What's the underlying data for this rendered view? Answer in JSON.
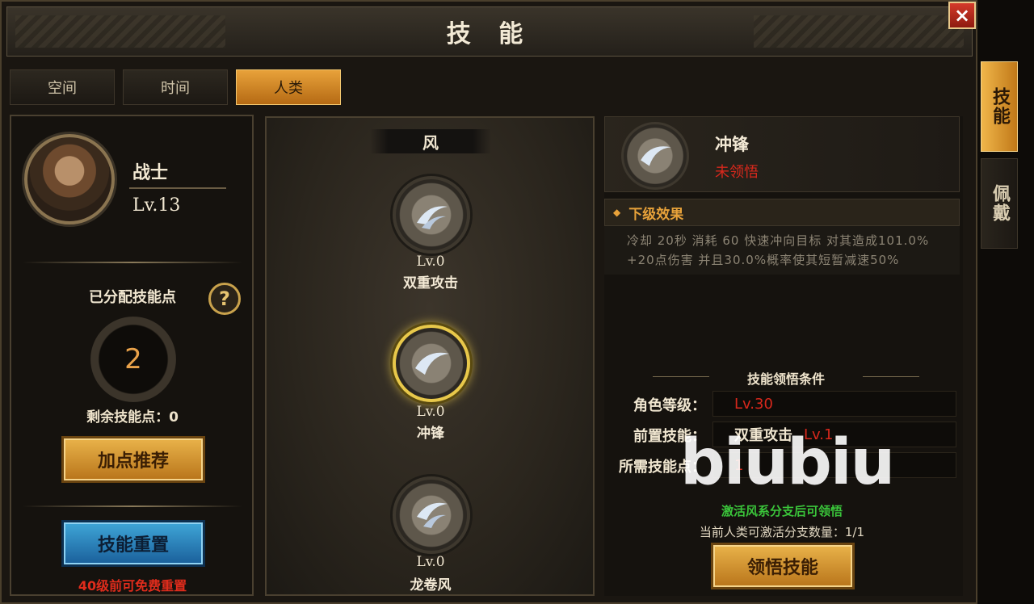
{
  "window": {
    "title": "技 能",
    "close_label": "×"
  },
  "tabs": [
    {
      "label": "空间",
      "active": false
    },
    {
      "label": "时间",
      "active": false
    },
    {
      "label": "人类",
      "active": true
    }
  ],
  "character": {
    "name": "战士",
    "level": "Lv.13",
    "allocated_label": "已分配技能点",
    "allocated_points": "2",
    "remaining_label": "剩余技能点：0",
    "recommend_button": "加点推荐",
    "reset_button": "技能重置",
    "free_reset_note": "40级前可免费重置"
  },
  "branch": {
    "title": "风",
    "skills": [
      {
        "level": "Lv.0",
        "name": "双重攻击"
      },
      {
        "level": "Lv.0",
        "name": "冲锋",
        "selected": true
      },
      {
        "level": "Lv.0",
        "name": "龙卷风"
      }
    ]
  },
  "detail": {
    "name": "冲锋",
    "status": "未领悟",
    "next_effect_label": "下级效果",
    "description": "冷却 20秒 消耗 60 快速冲向目标 对其造成101.0%+20点伤害 并且30.0%概率使其短暂减速50%",
    "conditions_title": "技能领悟条件",
    "conditions": [
      {
        "label": "角色等级：",
        "value": "Lv.30",
        "extra": ""
      },
      {
        "label": "前置技能：",
        "value": "双重攻击",
        "extra": "Lv.1"
      },
      {
        "label": "所需技能点：",
        "value": "1",
        "extra": ""
      }
    ],
    "hint_green": "激活风系分支后可领悟",
    "hint_count": "当前人类可激活分支数量：1/1",
    "learn_button": "领悟技能"
  },
  "side_tabs": [
    {
      "label": "技能",
      "active": true
    },
    {
      "label": "佩戴",
      "active": false
    }
  ],
  "watermark": "biubiu",
  "colors": {
    "gold": "#e8a23a",
    "red": "#d8281c",
    "green": "#3ac43a",
    "blue": "#2a7fbe"
  }
}
